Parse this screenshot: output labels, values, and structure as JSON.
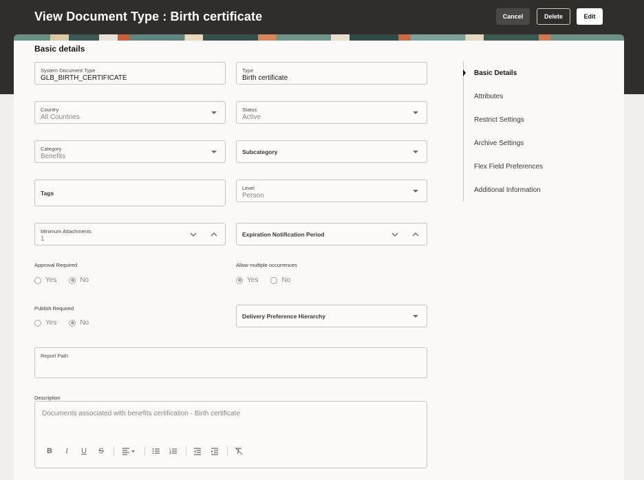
{
  "header": {
    "title": "View Document Type : Birth certificate",
    "cancel_label": "Cancel",
    "delete_label": "Delete",
    "edit_label": "Edit"
  },
  "section_title": "Basic details",
  "fields": {
    "system_document_type": {
      "label": "System Document Type",
      "value": "GLB_BIRTH_CERTIFICATE"
    },
    "type": {
      "label": "Type",
      "value": "Birth certificate"
    },
    "country": {
      "label": "Country",
      "value": "All Countries"
    },
    "status": {
      "label": "Status",
      "value": "Active"
    },
    "category": {
      "label": "Category",
      "value": "Benefits"
    },
    "subcategory": {
      "label": "Subcategory"
    },
    "tags": {
      "label": "Tags"
    },
    "level": {
      "label": "Level",
      "value": "Person"
    },
    "minimum_attachments": {
      "label": "Minimum Attachments",
      "value": "1"
    },
    "expiration_notification_period": {
      "label": "Expiration Notification Period"
    },
    "delivery_preference_hierarchy": {
      "label": "Delivery Preference Hierarchy"
    },
    "report_path": {
      "label": "Report Path"
    }
  },
  "radios": {
    "approval_required": {
      "label": "Approval Required",
      "yes": "Yes",
      "no": "No",
      "selected": "No"
    },
    "allow_multiple": {
      "label": "Allow multiple occurrences",
      "yes": "Yes",
      "no": "No",
      "selected": "Yes"
    },
    "publish_required": {
      "label": "Publish Required",
      "yes": "Yes",
      "no": "No",
      "selected": "No"
    }
  },
  "description": {
    "label": "Description",
    "value": "Documents associated with benefits certification - Birth certificate"
  },
  "toolbar": {
    "bold": "B",
    "italic": "I",
    "underline": "U",
    "strike": "S"
  },
  "nav": {
    "items": [
      {
        "label": "Basic Details",
        "active": true
      },
      {
        "label": "Attributes"
      },
      {
        "label": "Restrict Settings"
      },
      {
        "label": "Archive Settings"
      },
      {
        "label": "Flex Field Preferences"
      },
      {
        "label": "Additional Information"
      }
    ]
  }
}
